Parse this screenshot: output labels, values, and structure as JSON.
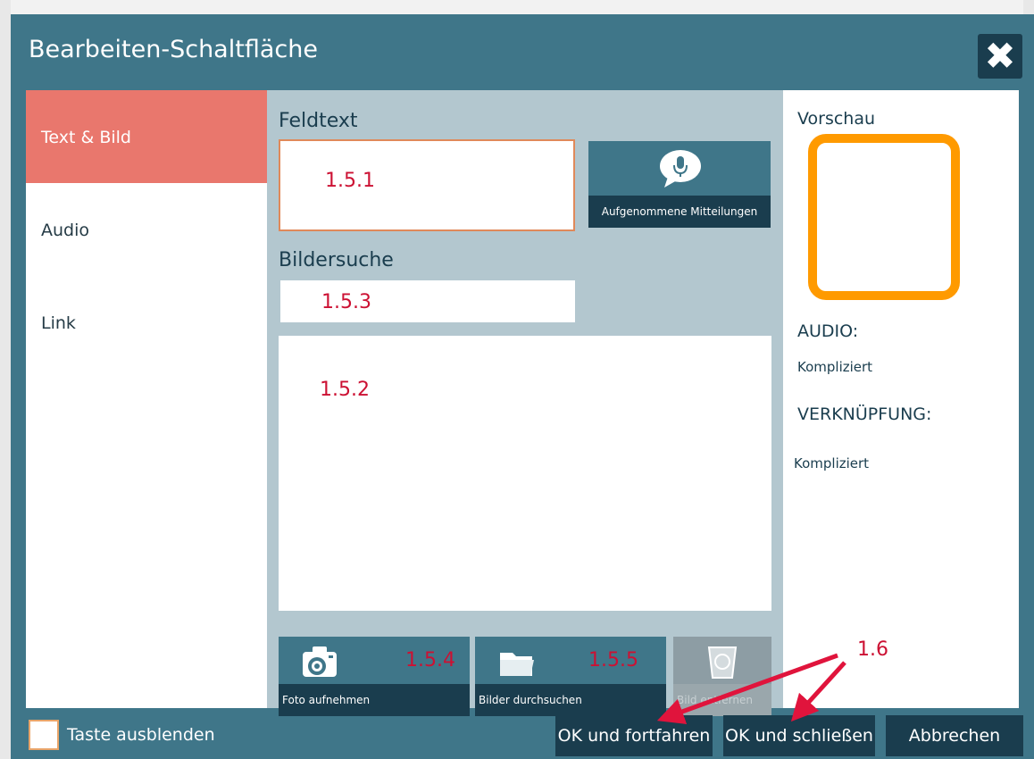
{
  "dialog": {
    "title": "Bearbeiten-Schaltfläche"
  },
  "sidebar": {
    "items": [
      {
        "label": "Text & Bild"
      },
      {
        "label": "Audio"
      },
      {
        "label": "Link"
      }
    ]
  },
  "center": {
    "feldtext_label": "Feldtext",
    "feldtext_annotation": "1.5.1",
    "recorded_button_label": "Aufgenommene Mitteilungen",
    "bildersuche_label": "Bildersuche",
    "search_annotation": "1.5.3",
    "image_area_annotation": "1.5.2",
    "buttons": {
      "photo_label": "Foto aufnehmen",
      "photo_annotation": "1.5.4",
      "browse_label": "Bilder durchsuchen",
      "browse_annotation": "1.5.5",
      "remove_label": "Bild entfernen"
    }
  },
  "preview": {
    "title": "Vorschau",
    "audio_label": "AUDIO:",
    "audio_value": "Kompliziert",
    "link_label": "VERKNÜPFUNG:",
    "link_value": "Kompliziert"
  },
  "footer": {
    "hide_label": "Taste ausblenden",
    "ok_continue": "OK und fortfahren",
    "ok_close": "OK und schließen",
    "cancel": "Abbrechen",
    "annotation": "1.6"
  },
  "colors": {
    "accent_active": "#e9776d",
    "dialog_bg": "#3f7689",
    "dark_button": "#1a3d4e",
    "preview_border": "#ff9a00",
    "annotation": "#cc1133"
  },
  "icons": [
    "close-icon",
    "speech-bubble-microphone-icon",
    "camera-icon",
    "folder-icon",
    "trash-icon"
  ]
}
